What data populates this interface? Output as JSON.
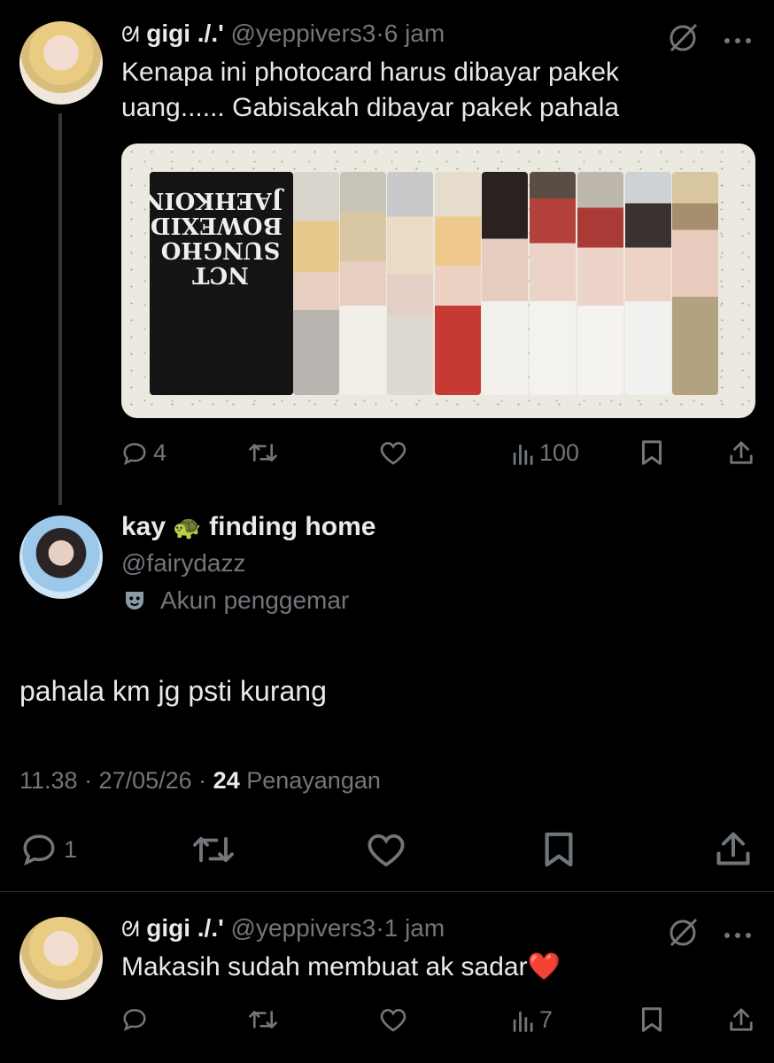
{
  "tweet1": {
    "name": "gigi ./.'",
    "handle": "@yeppivers3",
    "sep": "·",
    "time": "6 jam",
    "text": "Kenapa ini photocard harus dibayar pakek uang...... Gabisakah dibayar pakek pahala",
    "cover_text": "NCT SUNGHO BOWEXIDOOR JAEHKOIN",
    "reply_count": "4",
    "views": "100"
  },
  "main_tweet": {
    "name": "kay",
    "name_suffix": "finding home",
    "handle": "@fairydazz",
    "badge": "Akun penggemar",
    "text": "pahala km jg psti kurang",
    "timestamp": "11.38 · 27/05/26 ·",
    "view_count": "24",
    "views_label": "Penayangan",
    "reply_count": "1"
  },
  "tweet3": {
    "name": "gigi ./.'",
    "handle": "@yeppivers3",
    "sep": "·",
    "time": "1 jam",
    "text": "Makasih sudah membuat ak sadar❤️",
    "views": "7"
  },
  "colors": {
    "background": "#000000",
    "text": "#e7e9ea",
    "muted": "#71767b",
    "divider": "#2f3336",
    "heart": "#f91880"
  },
  "icons": [
    "reply-icon",
    "retweet-icon",
    "like-icon",
    "views-icon",
    "bookmark-icon",
    "share-icon",
    "grok-icon",
    "more-icon",
    "fan-mask-icon",
    "swirl-icon",
    "turtle-icon"
  ]
}
